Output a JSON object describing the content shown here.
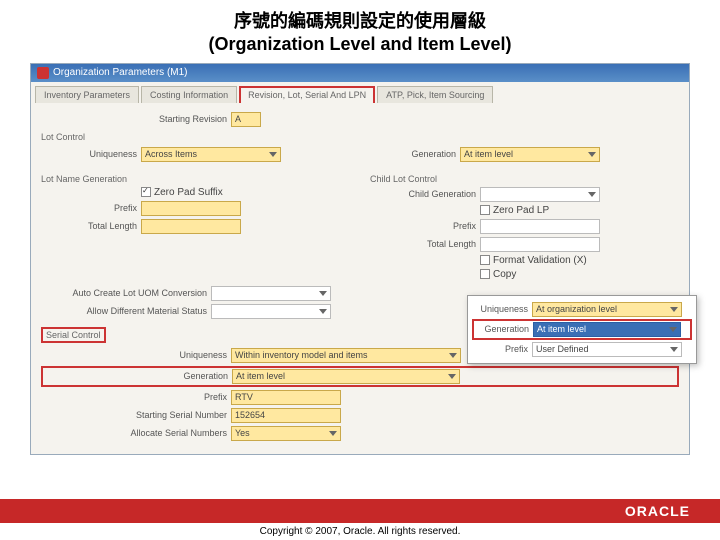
{
  "slide": {
    "title_zh": "序號的編碼規則設定的使用層級",
    "title_en": "(Organization Level and Item Level)"
  },
  "window": {
    "title": "Organization Parameters (M1)"
  },
  "tabs": {
    "t0": "Inventory Parameters",
    "t1": "Costing Information",
    "t2": "Revision, Lot, Serial And LPN",
    "t3": "ATP, Pick, Item Sourcing"
  },
  "labels": {
    "starting_revision": "Starting Revision",
    "lot_control": "Lot Control",
    "uniqueness": "Uniqueness",
    "generation": "Generation",
    "lot_name_gen": "Lot Name Generation",
    "child_lot_ctrl": "Child Lot Control",
    "child_gen": "Child Generation",
    "zero_pad_suffix": "Zero Pad Suffix",
    "zero_pad_lp": "Zero Pad LP",
    "prefix": "Prefix",
    "total_length": "Total Length",
    "format_val": "Format Validation (X)",
    "copy": "Copy",
    "auto_create": "Auto Create Lot UOM Conversion",
    "allow_diff": "Allow Different Material Status",
    "serial_control": "Serial Control",
    "starting_serial": "Starting Serial Number",
    "allocate_serial": "Allocate Serial Numbers",
    "user_defined": "User Defined"
  },
  "values": {
    "starting_revision": "A",
    "uniqueness": "Across Items",
    "generation_lot": "At item level",
    "uniqueness_serial": "Within inventory model and items",
    "generation_serial": "At item level",
    "prefix_serial": "RTV",
    "starting_serial": "152654",
    "allocate_serial": "Yes",
    "ov_uniqueness": "At organization level",
    "ov_generation": "At item level"
  },
  "footer": {
    "brand": "ORACLE",
    "copyright": "Copyright © 2007, Oracle. All rights reserved."
  }
}
